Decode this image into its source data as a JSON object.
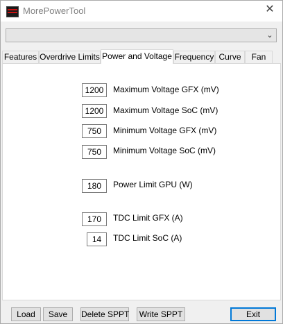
{
  "window": {
    "title": "MorePowerTool",
    "close_glyph": "✕",
    "icon": "mpt-app-icon"
  },
  "combo": {
    "selected_value": "",
    "arrow_glyph": "⌄"
  },
  "tabs": [
    {
      "label": "Features",
      "active": false
    },
    {
      "label": "Overdrive Limits",
      "active": false
    },
    {
      "label": "Power and Voltage",
      "active": true
    },
    {
      "label": "Frequency",
      "active": false
    },
    {
      "label": "Curve",
      "active": false
    },
    {
      "label": "Fan",
      "active": false
    }
  ],
  "fields": {
    "max_voltage_gfx": {
      "label": "Maximum Voltage GFX (mV)",
      "value": "1200"
    },
    "max_voltage_soc": {
      "label": "Maximum Voltage SoC (mV)",
      "value": "1200"
    },
    "min_voltage_gfx": {
      "label": "Minimum Voltage GFX (mV)",
      "value": "750"
    },
    "min_voltage_soc": {
      "label": "Minimum Voltage SoC (mV)",
      "value": "750"
    },
    "power_limit_gpu": {
      "label": "Power Limit GPU (W)",
      "value": "180"
    },
    "tdc_limit_gfx": {
      "label": "TDC Limit GFX (A)",
      "value": "170"
    },
    "tdc_limit_soc": {
      "label": "TDC Limit SoC (A)",
      "value": "14"
    }
  },
  "buttons": {
    "load": "Load",
    "save": "Save",
    "delete_sppt": "Delete SPPT",
    "write_sppt": "Write SPPT",
    "exit": "Exit"
  },
  "colors": {
    "window_bg": "#f0f0f0",
    "panel_bg": "#ffffff",
    "accent_focus": "#0078d7",
    "icon_red": "#cc1010"
  }
}
